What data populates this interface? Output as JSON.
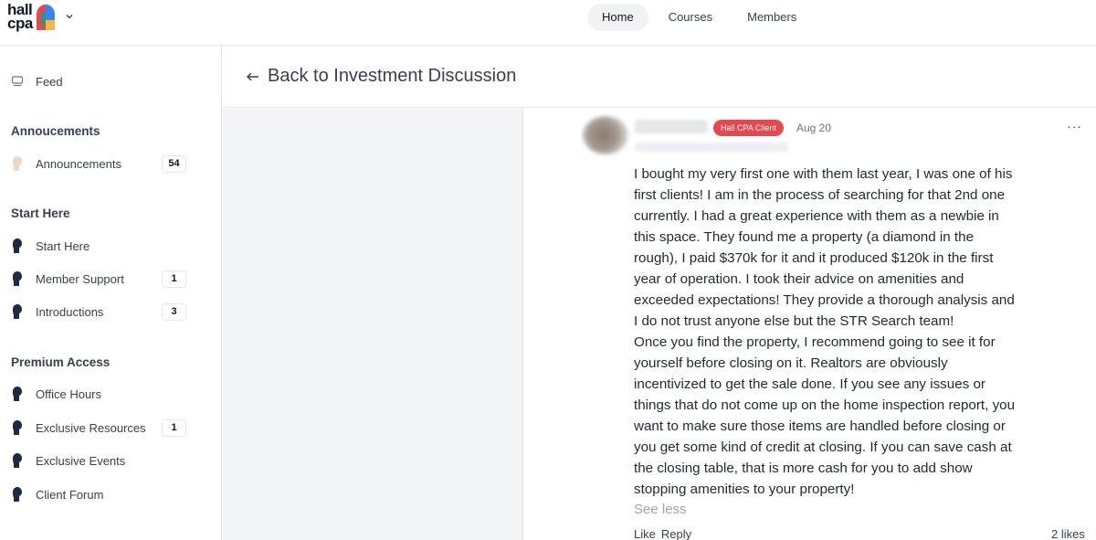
{
  "brand": {
    "logo_text_line1": "hall",
    "logo_text_line2": "cpa"
  },
  "topnav": {
    "items": [
      {
        "label": "Home",
        "active": true
      },
      {
        "label": "Courses",
        "active": false
      },
      {
        "label": "Members",
        "active": false
      }
    ]
  },
  "sidebar": {
    "feed": {
      "label": "Feed",
      "icon": "feed-icon"
    },
    "sections": [
      {
        "heading": "Annoucements",
        "items": [
          {
            "label": "Announcements",
            "badge": "54",
            "icon": "person-tan-icon"
          }
        ]
      },
      {
        "heading": "Start Here",
        "items": [
          {
            "label": "Start Here",
            "badge": "",
            "icon": "person-navy-icon"
          },
          {
            "label": "Member Support",
            "badge": "1",
            "icon": "person-navy-icon"
          },
          {
            "label": "Introductions",
            "badge": "3",
            "icon": "person-navy-icon"
          }
        ]
      },
      {
        "heading": "Premium Access",
        "items": [
          {
            "label": "Office Hours",
            "badge": "",
            "icon": "person-navy-icon"
          },
          {
            "label": "Exclusive Resources",
            "badge": "1",
            "icon": "person-navy-icon"
          },
          {
            "label": "Exclusive Events",
            "badge": "",
            "icon": "person-navy-icon"
          },
          {
            "label": "Client Forum",
            "badge": "",
            "icon": "person-navy-icon"
          }
        ]
      }
    ]
  },
  "main": {
    "back_label": "Back to Investment Discussion",
    "post": {
      "badge": "Hall CPA Client",
      "date": "Aug 20",
      "more": "···",
      "body": "I bought my very first one with them last year, I was one of his\nfirst clients! I am in the process of searching for that 2nd one\ncurrently. I had a great experience with them as a newbie in\nthis space. They found me a property (a diamond in the\nrough), I paid $370k for it and it produced $120k in the first\nyear of operation. I took their advice on amenities and\nexceeded expectations! They provide a thorough analysis and\nI do not trust anyone else but the STR Search team!\nOnce you find the property, I recommend going to see it for\nyourself before closing on it. Realtors are obviously\nincentivized to get the sale done. If you see any issues or\nthings that do not come up on the home inspection report, you\nwant to make sure those items are handled before closing or\nyou get some kind of credit at closing. If you can save cash at\nthe closing table, that is more cash for you to add show\nstopping amenities to your property!",
      "see_less": "See less",
      "like": "Like",
      "reply": "Reply",
      "likes": "2 likes"
    }
  },
  "colors": {
    "accent_red": "#e5484d",
    "navy": "#1e2a44",
    "tan": "#e8d9c4"
  }
}
